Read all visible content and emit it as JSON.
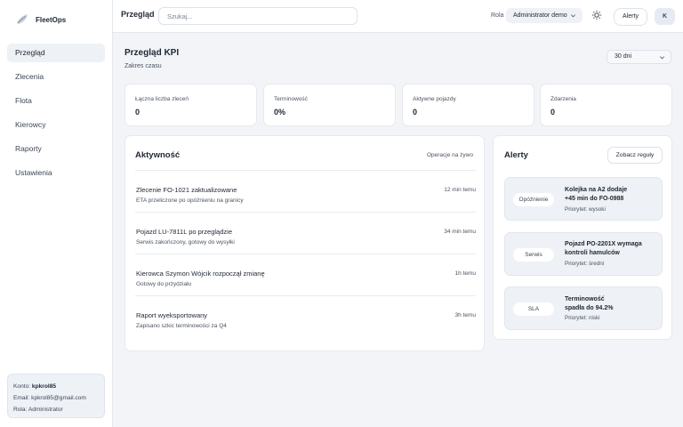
{
  "app": {
    "name": "FleetOps"
  },
  "sidebar": {
    "items": [
      {
        "label": "Przegląd",
        "active": true
      },
      {
        "label": "Zlecenia"
      },
      {
        "label": "Flota"
      },
      {
        "label": "Kierowcy"
      },
      {
        "label": "Raporty"
      },
      {
        "label": "Ustawienia"
      }
    ],
    "account": {
      "account_label": "Konto:",
      "account_value": "kpkrol85",
      "email_label": "Email:",
      "email_value": "kpkrol85@gmail.com",
      "role_label": "Rola:",
      "role_value": "Administrator"
    }
  },
  "topbar": {
    "title": "Przegląd",
    "search_placeholder": "Szukaj...",
    "role_label": "Rola",
    "role_value": "Administrator demo",
    "alerts_button": "Alerty",
    "avatar_initial": "K"
  },
  "kpi": {
    "title": "Przegląd KPI",
    "subtitle": "Zakres czasu",
    "range": "30 dni",
    "cards": [
      {
        "label": "Łączna liczba zleceń",
        "value": "0"
      },
      {
        "label": "Terminowość",
        "value": "0%"
      },
      {
        "label": "Aktywne pojazdy",
        "value": "0"
      },
      {
        "label": "Zdarzenia",
        "value": "0"
      }
    ]
  },
  "activity": {
    "title": "Aktywność",
    "meta": "Operacje na żywo",
    "items": [
      {
        "title": "Zlecenie FO-1021 zaktualizowane",
        "sub": "ETA przeliczone po opóźnieniu na granicy",
        "time": "12 min temu"
      },
      {
        "title": "Pojazd LU-7811L po przeglądzie",
        "sub": "Serwis zakończony, gotowy do wysyłki",
        "time": "34 min temu"
      },
      {
        "title": "Kierowca Szymon Wójcik rozpoczął zmianę",
        "sub": "Gotowy do przydziału",
        "time": "1h temu"
      },
      {
        "title": "Raport wyeksportowany",
        "sub": "Zapisano szkic terminowości za Q4",
        "time": "3h temu"
      }
    ]
  },
  "alerts": {
    "title": "Alerty",
    "button": "Zobacz reguły",
    "items": [
      {
        "tag": "Opóźnienie",
        "line1": "Kolejka na A2 dodaje",
        "line2": "+45 min do FO-0988",
        "priority": "Priorytet: wysoki"
      },
      {
        "tag": "Serwis",
        "line1": "Pojazd PO-2201X wymaga",
        "line2": "kontroli hamulców",
        "priority": "Priorytet: średni"
      },
      {
        "tag": "SLA",
        "line1": "Terminowość",
        "line2": "spadła do 94.2%",
        "priority": "Priorytet: niski"
      }
    ]
  }
}
